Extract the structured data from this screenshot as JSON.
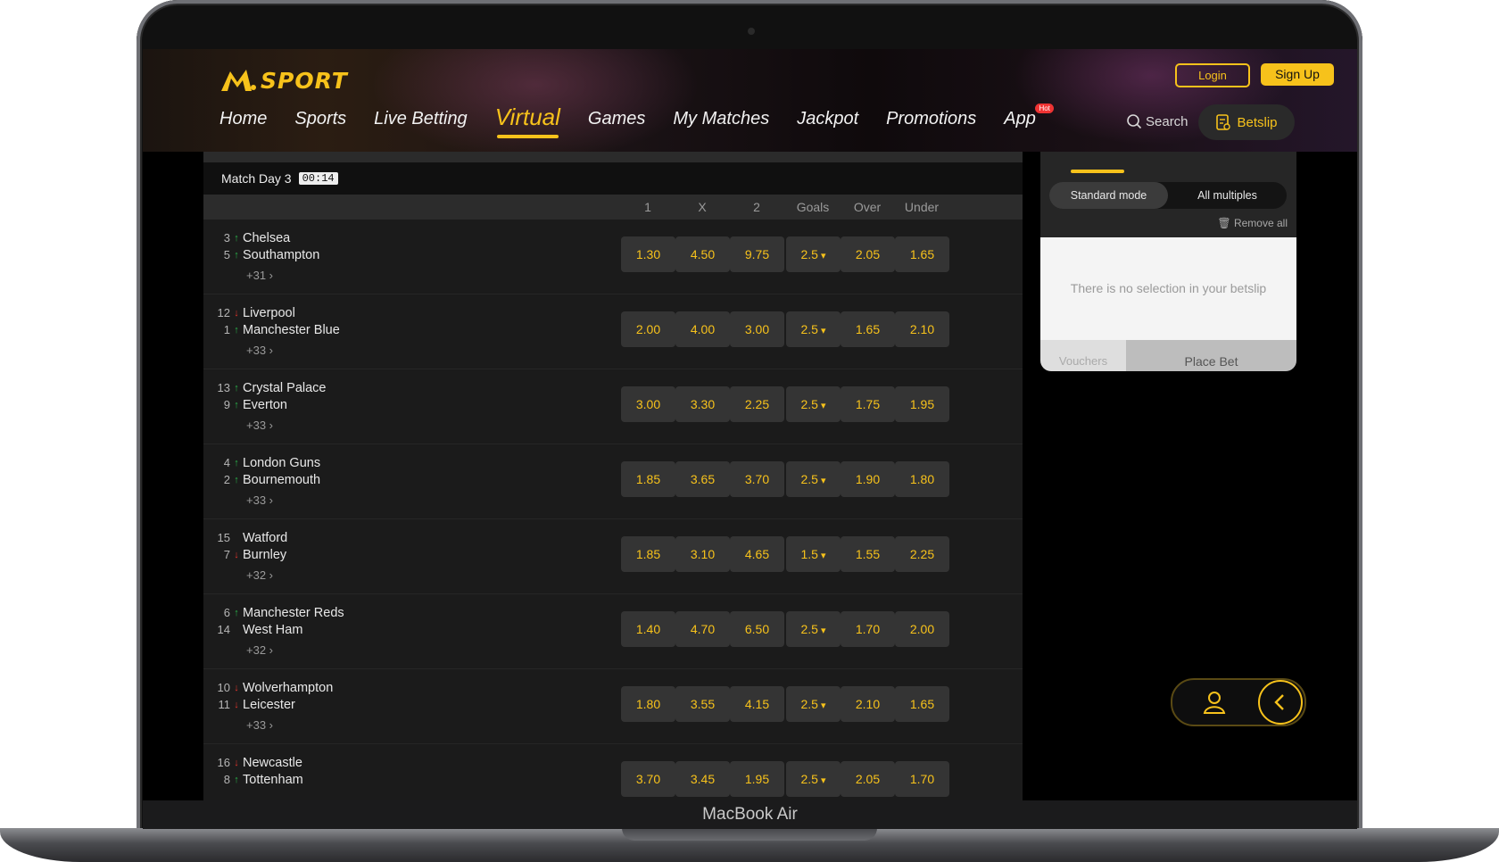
{
  "device": {
    "label": "MacBook Air"
  },
  "brand": {
    "logo_text": "SPORT",
    "accent": "#f7c21b"
  },
  "auth": {
    "login": "Login",
    "signup": "Sign Up"
  },
  "nav": {
    "items": [
      "Home",
      "Sports",
      "Live Betting",
      "Virtual",
      "Games",
      "My Matches",
      "Jackpot",
      "Promotions",
      "App"
    ],
    "active": "Virtual",
    "app_badge": "Hot"
  },
  "search_label": "Search",
  "betslip_label": "Betslip",
  "matchday": {
    "title": "Match Day 3",
    "timer": "00:14"
  },
  "columns": [
    "1",
    "X",
    "2",
    "Goals",
    "Over",
    "Under"
  ],
  "matches": [
    {
      "home": {
        "rank": "3",
        "trend": "up",
        "name": "Chelsea"
      },
      "away": {
        "rank": "5",
        "trend": "up",
        "name": "Southampton"
      },
      "more": "+31",
      "odds": [
        "1.30",
        "4.50",
        "9.75"
      ],
      "goals": "2.5",
      "over": "2.05",
      "under": "1.65"
    },
    {
      "home": {
        "rank": "12",
        "trend": "down",
        "name": "Liverpool"
      },
      "away": {
        "rank": "1",
        "trend": "up",
        "name": "Manchester Blue"
      },
      "more": "+33",
      "odds": [
        "2.00",
        "4.00",
        "3.00"
      ],
      "goals": "2.5",
      "over": "1.65",
      "under": "2.10"
    },
    {
      "home": {
        "rank": "13",
        "trend": "up",
        "name": "Crystal Palace"
      },
      "away": {
        "rank": "9",
        "trend": "up",
        "name": "Everton"
      },
      "more": "+33",
      "odds": [
        "3.00",
        "3.30",
        "2.25"
      ],
      "goals": "2.5",
      "over": "1.75",
      "under": "1.95"
    },
    {
      "home": {
        "rank": "4",
        "trend": "up",
        "name": "London Guns"
      },
      "away": {
        "rank": "2",
        "trend": "up",
        "name": "Bournemouth"
      },
      "more": "+33",
      "odds": [
        "1.85",
        "3.65",
        "3.70"
      ],
      "goals": "2.5",
      "over": "1.90",
      "under": "1.80"
    },
    {
      "home": {
        "rank": "15",
        "trend": "none",
        "name": "Watford"
      },
      "away": {
        "rank": "7",
        "trend": "down",
        "name": "Burnley"
      },
      "more": "+32",
      "odds": [
        "1.85",
        "3.10",
        "4.65"
      ],
      "goals": "1.5",
      "over": "1.55",
      "under": "2.25"
    },
    {
      "home": {
        "rank": "6",
        "trend": "up",
        "name": "Manchester Reds"
      },
      "away": {
        "rank": "14",
        "trend": "none",
        "name": "West Ham"
      },
      "more": "+32",
      "odds": [
        "1.40",
        "4.70",
        "6.50"
      ],
      "goals": "2.5",
      "over": "1.70",
      "under": "2.00"
    },
    {
      "home": {
        "rank": "10",
        "trend": "down",
        "name": "Wolverhampton"
      },
      "away": {
        "rank": "11",
        "trend": "down",
        "name": "Leicester"
      },
      "more": "+33",
      "odds": [
        "1.80",
        "3.55",
        "4.15"
      ],
      "goals": "2.5",
      "over": "2.10",
      "under": "1.65"
    },
    {
      "home": {
        "rank": "16",
        "trend": "down",
        "name": "Newcastle"
      },
      "away": {
        "rank": "8",
        "trend": "up",
        "name": "Tottenham"
      },
      "more": "",
      "odds": [
        "3.70",
        "3.45",
        "1.95"
      ],
      "goals": "2.5",
      "over": "2.05",
      "under": "1.70"
    }
  ],
  "betslip": {
    "modes": [
      "Standard mode",
      "All multiples"
    ],
    "active_mode": "Standard mode",
    "remove_all": "Remove all",
    "empty_message": "There is no selection in your betslip",
    "vouchers": "Vouchers",
    "place_bet": "Place Bet"
  },
  "float_widget": {
    "icons": [
      "user-icon",
      "chevron-left-icon"
    ]
  }
}
